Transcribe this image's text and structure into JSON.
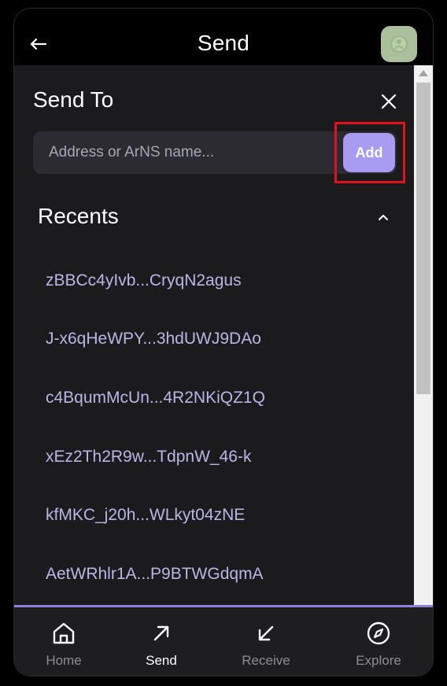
{
  "header": {
    "title": "Send",
    "back_icon": "arrow-left-icon",
    "avatar_color": "#a9c09a"
  },
  "sheet": {
    "title": "Send To",
    "close_icon": "close-icon",
    "address_input": {
      "placeholder": "Address or ArNS name...",
      "value": ""
    },
    "add_button": "Add",
    "recents": {
      "title": "Recents",
      "collapse_icon": "chevron-up-icon",
      "items": [
        "zBBCc4yIvb...CryqN2agus",
        "J-x6qHeWPY...3hdUWJ9DAo",
        "c4BqumMcUn...4R2NKiQZ1Q",
        "xEz2Th2R9w...TdpnW_46-k",
        "kfMKC_j20h...WLkyt04zNE",
        "AetWRhlr1A...P9BTWGdqmA"
      ]
    }
  },
  "nav": {
    "items": [
      {
        "label": "Home",
        "icon": "home-icon",
        "active": false
      },
      {
        "label": "Send",
        "icon": "arrow-up-right-icon",
        "active": true
      },
      {
        "label": "Receive",
        "icon": "arrow-down-left-icon",
        "active": false
      },
      {
        "label": "Explore",
        "icon": "compass-icon",
        "active": false
      }
    ]
  },
  "colors": {
    "accent": "#a89bf2",
    "highlight": "#e3111c",
    "recent_text": "#b9b6e6",
    "sheet_bg": "#1b1b1e"
  }
}
